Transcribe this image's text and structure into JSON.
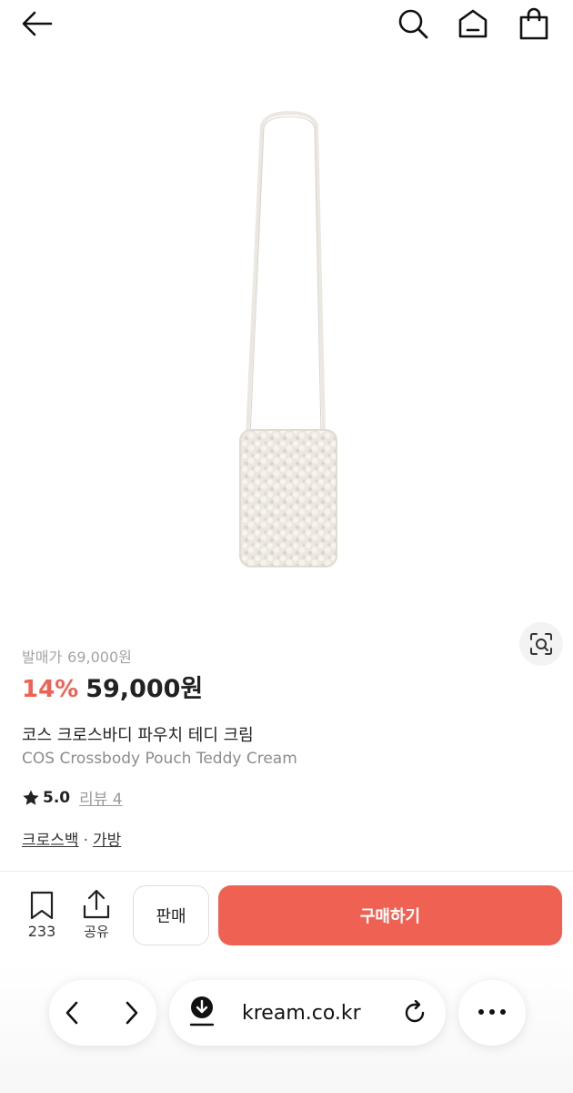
{
  "header": {
    "back_icon": "arrow-left-icon",
    "search_icon": "search-icon",
    "home_icon": "home-icon",
    "cart_icon": "shopping-bag-icon"
  },
  "product": {
    "release_label": "발매가",
    "release_price": "69,000원",
    "discount": "14%",
    "price": "59,000원",
    "name_ko": "코스 크로스바디 파우치 테디 크림",
    "name_en": "COS Crossbody Pouch Teddy Cream",
    "rating": "5.0",
    "review_label": "리뷰 4",
    "categories": [
      "크로스백",
      "가방"
    ],
    "category_separator": "·",
    "image_icon": "cream-teddy-pouch-image",
    "lens_icon": "visual-search-icon"
  },
  "actions": {
    "bookmark_count": "233",
    "share_label": "공유",
    "sell_label": "판매",
    "buy_label": "구매하기",
    "buy_color": "#ef6253"
  },
  "browser": {
    "url": "kream.co.kr",
    "back_icon": "chevron-left-icon",
    "forward_icon": "chevron-right-icon",
    "download_icon": "download-icon",
    "reload_icon": "reload-icon",
    "more_icon": "more-horizontal-icon"
  }
}
